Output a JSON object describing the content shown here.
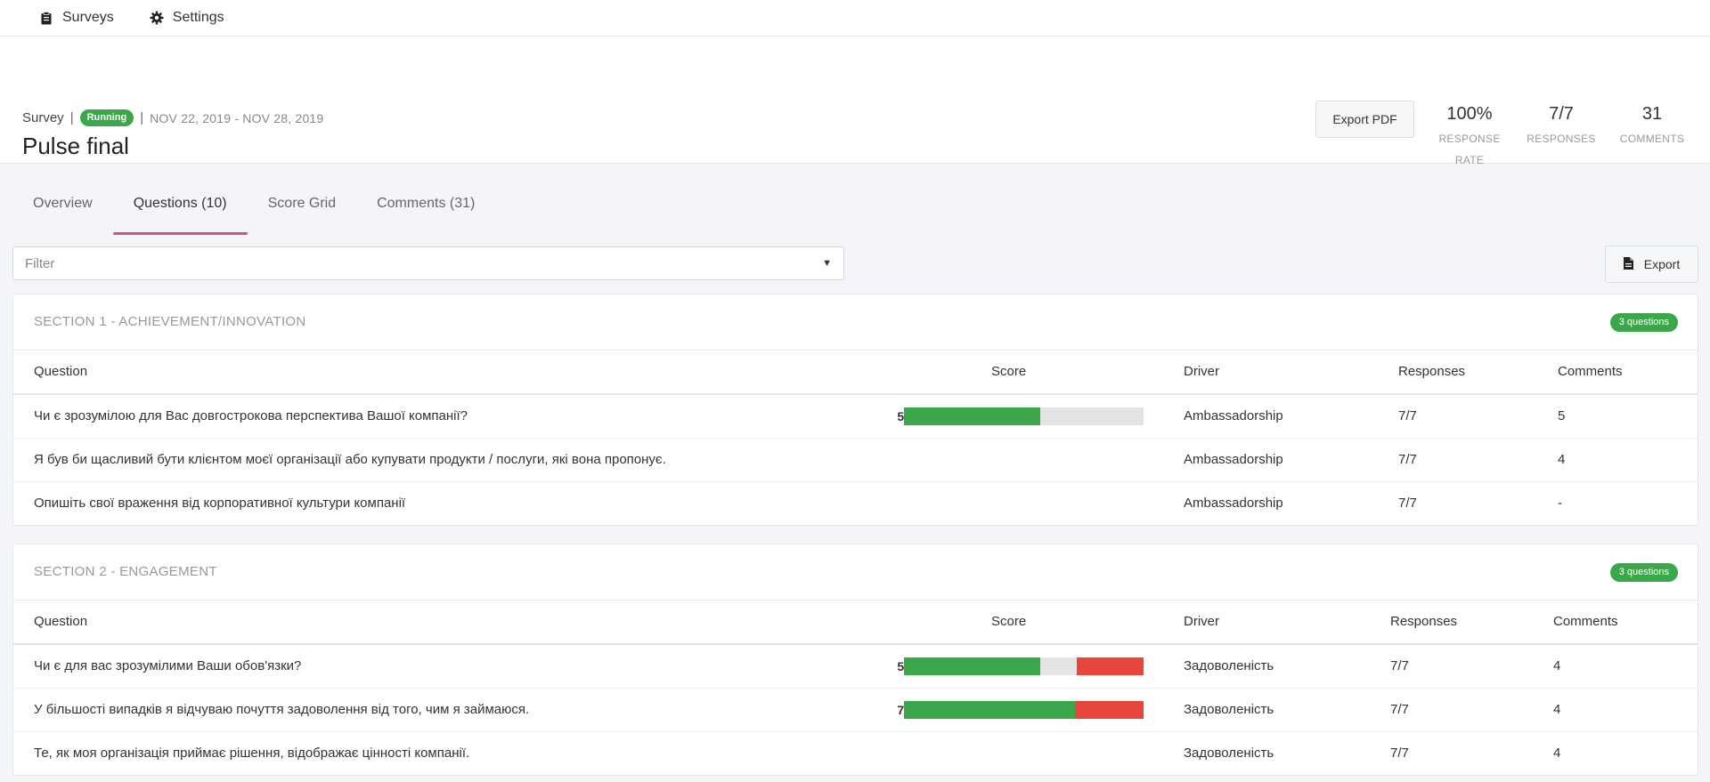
{
  "nav": {
    "surveys_label": "Surveys",
    "settings_label": "Settings"
  },
  "header": {
    "type_label": "Survey",
    "status": "Running",
    "date_range": "NOV 22, 2019 - NOV 28, 2019",
    "title": "Pulse final",
    "export_pdf_label": "Export PDF",
    "stats": [
      {
        "value": "100%",
        "label_line1": "RESPONSE",
        "label_line2": "RATE"
      },
      {
        "value": "7/7",
        "label_line1": "RESPONSES",
        "label_line2": ""
      },
      {
        "value": "31",
        "label_line1": "COMMENTS",
        "label_line2": ""
      }
    ]
  },
  "tabs": [
    "Overview",
    "Questions (10)",
    "Score Grid",
    "Comments (31)"
  ],
  "active_tab": "Questions (10)",
  "filter": {
    "placeholder": "Filter"
  },
  "export_label": "Export",
  "columns": {
    "question": "Question",
    "score": "Score",
    "driver": "Driver",
    "responses": "Responses",
    "comments": "Comments"
  },
  "colors": {
    "positive": "#3aa84a",
    "neutral": "#e4e4e4",
    "negative": "#e8453c",
    "accent_tab": "#d8517f"
  },
  "sections": [
    {
      "title": "SECTION 1 - ACHIEVEMENT/INNOVATION",
      "badge": "3 questions",
      "questions": [
        {
          "text": "Чи є зрозумілою для Вас довгострокова перспектива Вашої компанії?",
          "score": "57",
          "bar": {
            "positive": 0.57,
            "neutral": 0.43,
            "negative": 0
          },
          "driver": "Ambassadorship",
          "responses": "7/7",
          "comments": "5"
        },
        {
          "text": "Я був би щасливий бути клієнтом моєї організації або купувати продукти / послуги, які вона пропонує.",
          "score": "",
          "bar": null,
          "driver": "Ambassadorship",
          "responses": "7/7",
          "comments": "4"
        },
        {
          "text": "Опишіть свої враження від корпоративної культури компанії",
          "score": "",
          "bar": null,
          "driver": "Ambassadorship",
          "responses": "7/7",
          "comments": "-"
        }
      ]
    },
    {
      "title": "SECTION 2 - ENGAGEMENT",
      "badge": "3 questions",
      "questions": [
        {
          "text": "Чи є для вас зрозумілими Ваши обов'язки?",
          "score": "57",
          "bar": {
            "positive": 0.57,
            "neutral": 0.15,
            "negative": 0.28
          },
          "driver": "Задоволеність",
          "responses": "7/7",
          "comments": "4"
        },
        {
          "text": "У більшості випадків я відчуваю почуття задоволення від того, чим я займаюся.",
          "score": "71",
          "bar": {
            "positive": 0.715,
            "neutral": 0,
            "negative": 0.285
          },
          "driver": "Задоволеність",
          "responses": "7/7",
          "comments": "4"
        },
        {
          "text": "Те, як моя організація приймає рішення, відображає цінності компанії.",
          "score": "",
          "bar": null,
          "driver": "Задоволеність",
          "responses": "7/7",
          "comments": "4"
        }
      ]
    }
  ]
}
